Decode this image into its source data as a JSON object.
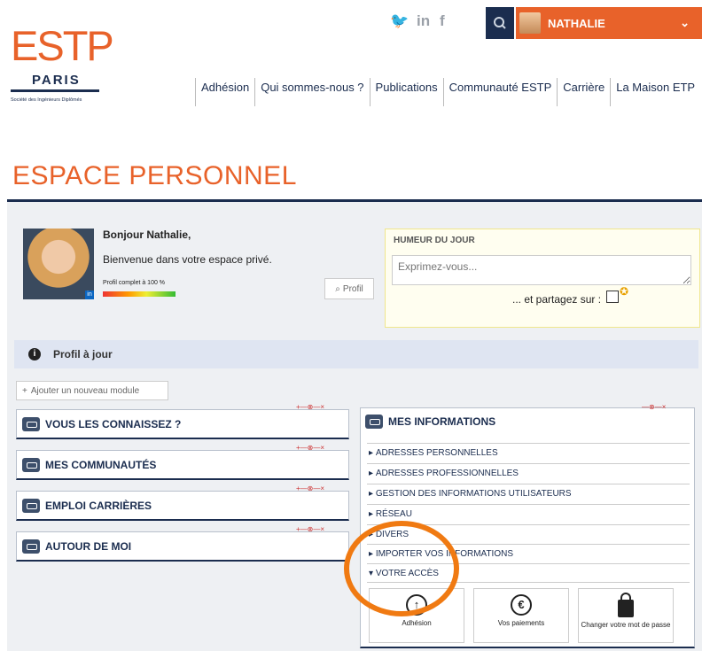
{
  "logo": {
    "main": "ESTP",
    "city": "PARIS",
    "tagline": "Société des Ingénieurs Diplômés"
  },
  "social": [
    "twitter-icon",
    "linkedin-icon",
    "facebook-icon"
  ],
  "user": {
    "name": "NATHALIE"
  },
  "nav": [
    "Adhésion",
    "Qui sommes-nous ?",
    "Publications",
    "Communauté ESTP",
    "Carrière",
    "La Maison ETP"
  ],
  "page_title": "ESPACE PERSONNEL",
  "profile": {
    "greeting": "Bonjour Nathalie,",
    "welcome": "Bienvenue dans votre espace privé.",
    "complete": "Profil complet à 100 %",
    "button": "Profil",
    "completion_percent": 100
  },
  "humeur": {
    "title": "HUMEUR DU JOUR",
    "placeholder": "Exprimez-vous...",
    "share": "... et partagez sur :"
  },
  "info_bar": "Profil à jour",
  "add_module": "Ajouter un nouveau module",
  "modules": [
    "VOUS LES CONNAISSEZ ?",
    "MES COMMUNAUTÉS",
    "EMPLOI CARRIÈRES",
    "AUTOUR DE MOI"
  ],
  "mes_informations": {
    "title": "MES INFORMATIONS",
    "rows": [
      "ADRESSES PERSONNELLES",
      "ADRESSES PROFESSIONNELLES",
      "GESTION DES INFORMATIONS UTILISATEURS",
      "RÉSEAU",
      "DIVERS",
      "IMPORTER VOS INFORMATIONS",
      "VOTRE ACCÈS"
    ],
    "tiles": [
      {
        "label": "Adhésion",
        "icon": "arrow-up-icon"
      },
      {
        "label": "Vos paiements",
        "icon": "euro-icon"
      },
      {
        "label": "Changer votre mot de passe",
        "icon": "lock-icon"
      }
    ]
  },
  "colors": {
    "brand": "#e8622a",
    "navy": "#1b2d4f",
    "highlight": "#f07a12"
  }
}
